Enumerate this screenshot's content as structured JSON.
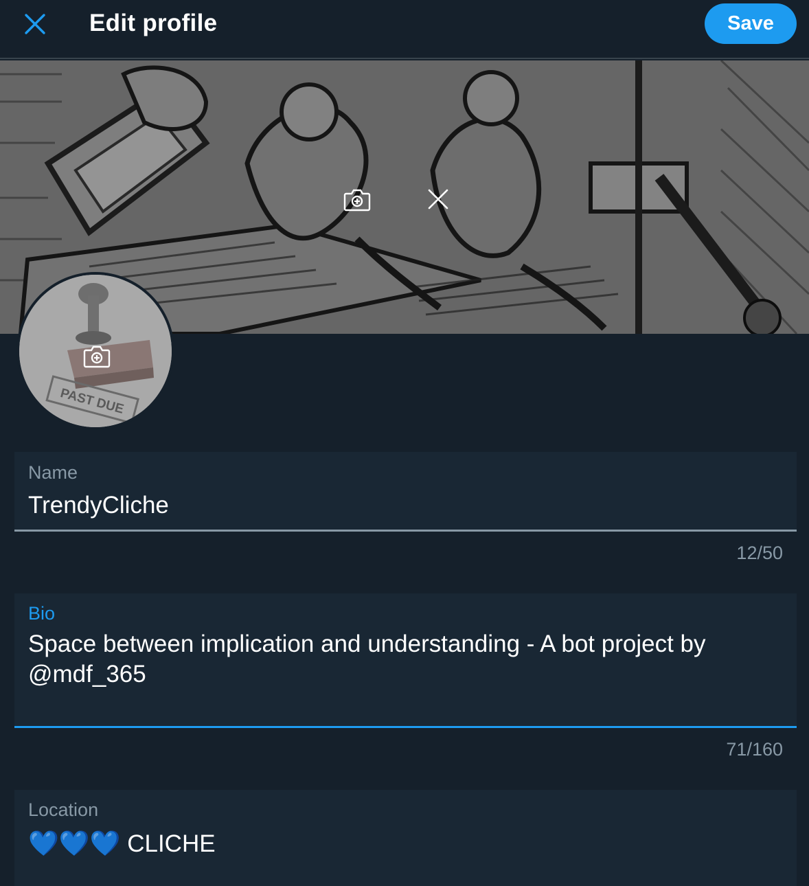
{
  "header": {
    "title": "Edit profile",
    "save_label": "Save",
    "close_icon": "close-icon"
  },
  "banner": {
    "add_photo_icon": "camera-plus-icon",
    "remove_photo_icon": "close-icon"
  },
  "avatar": {
    "add_photo_icon": "camera-plus-icon",
    "stamp_text": "PAST DUE"
  },
  "fields": {
    "name": {
      "label": "Name",
      "value": "TrendyCliche",
      "counter": "12/50"
    },
    "bio": {
      "label": "Bio",
      "value": "Space between implication and understanding - A bot project by @mdf_365",
      "counter": "71/160"
    },
    "location": {
      "label": "Location",
      "hearts": "💙💙💙",
      "value": "CLICHE"
    }
  },
  "colors": {
    "background": "#15202b",
    "field_background": "#192734",
    "accent": "#1d9bf0",
    "muted": "#8899a6"
  }
}
